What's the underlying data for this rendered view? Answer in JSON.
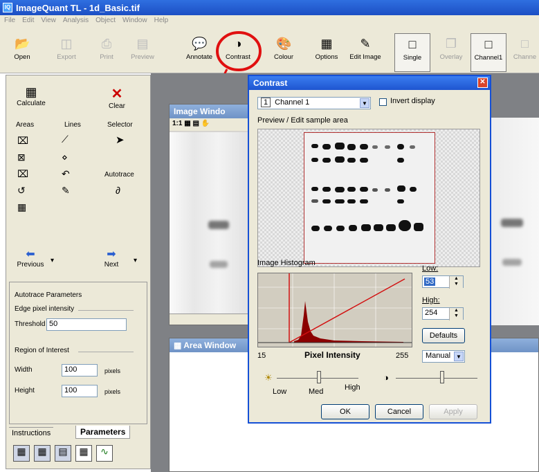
{
  "app": {
    "title": "ImageQuant TL - 1d_Basic.tif",
    "icon_text": "IQ"
  },
  "menu": [
    "File",
    "Edit",
    "View",
    "Analysis",
    "Object",
    "Window",
    "Help"
  ],
  "toolbar": [
    {
      "label": "Open",
      "icon": "open-folder-icon",
      "enabled": true
    },
    {
      "label": "Export",
      "icon": "export-icon",
      "enabled": false
    },
    {
      "label": "Print",
      "icon": "print-icon",
      "enabled": false
    },
    {
      "label": "Preview",
      "icon": "preview-icon",
      "enabled": false
    },
    {
      "label": "Annotate",
      "icon": "speech-bubble-icon",
      "enabled": true
    },
    {
      "label": "Contrast",
      "icon": "contrast-sun-icon",
      "enabled": true
    },
    {
      "label": "Colour",
      "icon": "palette-icon",
      "enabled": true
    },
    {
      "label": "Options",
      "icon": "options-icon",
      "enabled": true
    },
    {
      "label": "Edit Image",
      "icon": "edit-image-icon",
      "enabled": true
    },
    {
      "label": "Single",
      "icon": "single-view-icon",
      "enabled": true
    },
    {
      "label": "Overlay",
      "icon": "overlay-icon",
      "enabled": false
    },
    {
      "label": "Channel1",
      "icon": "channel1-icon",
      "enabled": true
    },
    {
      "label": "Channe",
      "icon": "channel2-icon",
      "enabled": false
    }
  ],
  "left_panel": {
    "calculate": "Calculate",
    "clear": "Clear",
    "areas": "Areas",
    "lines": "Lines",
    "selector": "Selector",
    "autotrace": "Autotrace",
    "previous": "Previous",
    "next": "Next",
    "autotrace_params": "Autotrace Parameters",
    "edge_pixel_intensity": "Edge pixel intensity",
    "threshold_label": "Threshold",
    "threshold_value": "50",
    "roi_label": "Region of Interest",
    "width_label": "Width",
    "width_value": "100",
    "width_unit": "pixels",
    "height_label": "Height",
    "height_value": "100",
    "height_unit": "pixels",
    "tab_instructions": "Instructions",
    "tab_parameters": "Parameters"
  },
  "image_window": {
    "title": "Image Windo",
    "zoom": "1:1"
  },
  "area_window": {
    "title": "Area Window"
  },
  "dialog": {
    "title": "Contrast",
    "channel_number": "1",
    "channel": "Channel 1",
    "invert_display": "Invert display",
    "preview_label": "Preview / Edit sample area",
    "histogram_label": "Image Histogram",
    "hist_min": "15",
    "hist_axis": "Pixel Intensity",
    "hist_max": "255",
    "low_label": "Low:",
    "low_value": "53",
    "high_label": "High:",
    "high_value": "254",
    "defaults": "Defaults",
    "mode": "Manual",
    "slider_low": "Low",
    "slider_med": "Med",
    "slider_high": "High",
    "ok": "OK",
    "cancel": "Cancel",
    "apply": "Apply"
  },
  "colors": {
    "highlight": "#e01010",
    "title_blue": "#1e55d0"
  }
}
